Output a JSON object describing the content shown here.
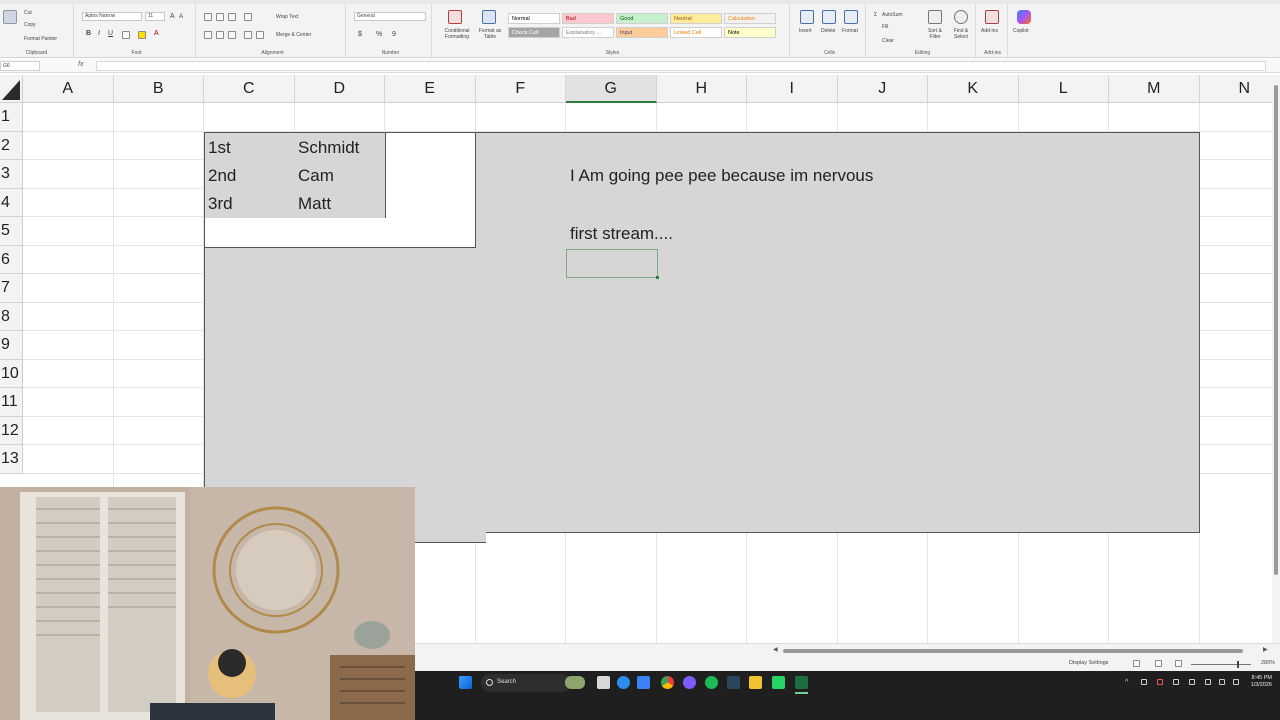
{
  "ribbon": {
    "clipboard": {
      "cut": "Cut",
      "copy": "Copy",
      "format_painter": "Format Painter",
      "label": "Clipboard"
    },
    "font": {
      "name": "Aptos Narrow",
      "size": "11",
      "label": "Font"
    },
    "alignment": {
      "wrap_text": "Wrap Text",
      "merge_center": "Merge & Center",
      "label": "Alignment"
    },
    "number": {
      "format": "General",
      "label": "Number"
    },
    "styles": {
      "conditional_formatting": "Conditional Formatting",
      "format_as_table": "Format as Table",
      "cells": [
        {
          "label": "Normal",
          "bg": "#ffffff",
          "fg": "#000000"
        },
        {
          "label": "Bad",
          "bg": "#ffc7ce",
          "fg": "#9c0006"
        },
        {
          "label": "Good",
          "bg": "#c6efce",
          "fg": "#006100"
        },
        {
          "label": "Neutral",
          "bg": "#ffeb9c",
          "fg": "#9c5700"
        },
        {
          "label": "Calculation",
          "bg": "#f2f2f2",
          "fg": "#fa7d00"
        },
        {
          "label": "Check Cell",
          "bg": "#a5a5a5",
          "fg": "#ffffff"
        },
        {
          "label": "Explanatory ...",
          "bg": "#ffffff",
          "fg": "#7f7f7f"
        },
        {
          "label": "Input",
          "bg": "#ffcc99",
          "fg": "#3f3f76"
        },
        {
          "label": "Linked Cell",
          "bg": "#ffffff",
          "fg": "#fa7d00"
        },
        {
          "label": "Note",
          "bg": "#ffffcc",
          "fg": "#000000"
        }
      ],
      "label": "Styles"
    },
    "cells_group": {
      "insert": "Insert",
      "delete": "Delete",
      "format": "Format",
      "label": "Cells"
    },
    "editing": {
      "autosum": "AutoSum",
      "fill": "Fill",
      "clear": "Clear",
      "sort_filter": "Sort & Filter",
      "find_select": "Find & Select",
      "label": "Editing"
    },
    "addins": {
      "label": "Add-ins",
      "button": "Add-ins"
    },
    "copilot": {
      "label": "Copilot"
    }
  },
  "formula_bar": {
    "name_box": "G6",
    "fx": "fx",
    "value": ""
  },
  "columns": [
    "A",
    "B",
    "C",
    "D",
    "E",
    "F",
    "G",
    "H",
    "I",
    "J",
    "K",
    "L",
    "M",
    "N"
  ],
  "selected_column": "G",
  "rows": [
    "1",
    "2",
    "3",
    "4",
    "5",
    "6",
    "7",
    "8",
    "9",
    "10",
    "11",
    "12",
    "13"
  ],
  "table": [
    {
      "place": "1st",
      "name": "Schmidt"
    },
    {
      "place": "2nd",
      "name": "Cam"
    },
    {
      "place": "3rd",
      "name": "Matt"
    }
  ],
  "notes": {
    "line1": "I Am going pee pee because im nervous",
    "line2": "first stream...."
  },
  "status": {
    "display_settings": "Display Settings",
    "zoom": "280%"
  },
  "taskbar": {
    "search": "Search",
    "time": "8:45 PM",
    "date": "1/3/2026"
  }
}
